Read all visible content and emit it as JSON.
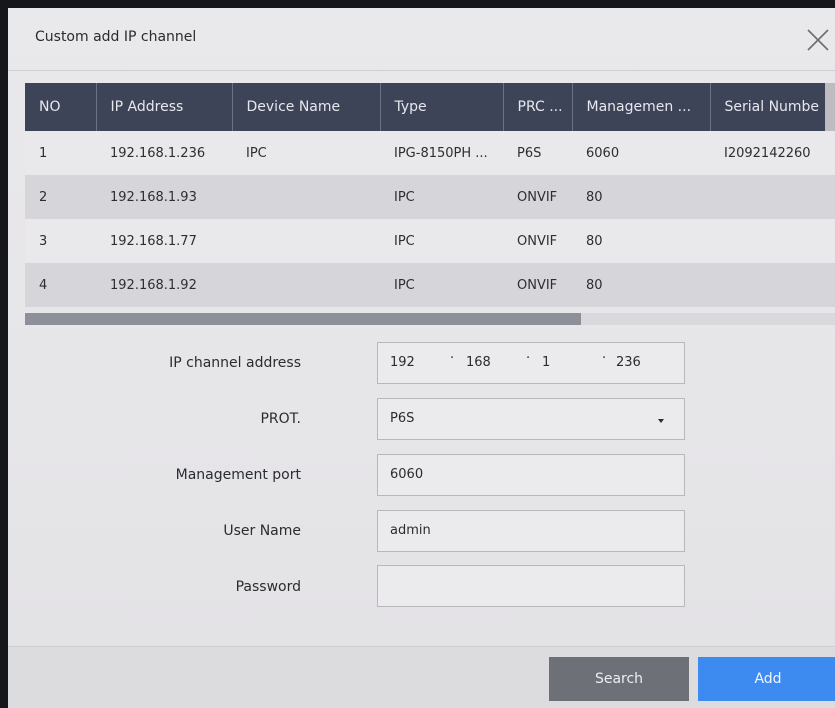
{
  "dialog": {
    "title": "Custom add IP channel"
  },
  "table": {
    "columns": [
      "NO",
      "IP Address",
      "Device Name",
      "Type",
      "PRC ...",
      "Managemen ...",
      "Serial Numbe"
    ],
    "rows": [
      [
        "1",
        "192.168.1.236",
        "IPC",
        "IPG-8150PH ...",
        "P6S",
        "6060",
        "I2092142260"
      ],
      [
        "2",
        "192.168.1.93",
        "",
        "IPC",
        "ONVIF",
        "80",
        ""
      ],
      [
        "3",
        "192.168.1.77",
        "",
        "IPC",
        "ONVIF",
        "80",
        ""
      ],
      [
        "4",
        "192.168.1.92",
        "",
        "IPC",
        "ONVIF",
        "80",
        ""
      ]
    ]
  },
  "form": {
    "ip_label": "IP channel address",
    "ip_parts": [
      "192",
      "168",
      "1",
      "236"
    ],
    "ip_separator": "·",
    "prot_label": "PROT.",
    "prot_value": "P6S",
    "port_label": "Management port",
    "port_value": "6060",
    "user_label": "User Name",
    "user_value": "admin",
    "password_label": "Password",
    "password_value": ""
  },
  "footer": {
    "search_label": "Search",
    "add_label": "Add"
  },
  "colors": {
    "header_bg": "#3e4458",
    "add_button": "#3d8bf0",
    "search_button": "#6d7077"
  }
}
